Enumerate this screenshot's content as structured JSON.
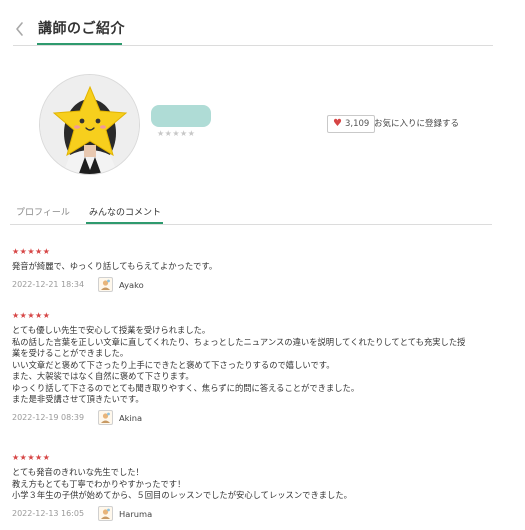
{
  "header": {
    "title": "講師のご紹介",
    "back_icon": "chevron-left-icon"
  },
  "profile": {
    "rating_stars": "★★★★★",
    "favorite_count": "3,109",
    "favorite_label": "お気に入りに登録する",
    "heart_icon": "♥",
    "colors": {
      "accent": "#2e9a6e",
      "name_pill": "#afdcd6",
      "star_rating": "#d64545",
      "heart": "#d64545"
    }
  },
  "tabs": [
    {
      "label": "プロフィール",
      "active": false
    },
    {
      "label": "みんなのコメント",
      "active": true
    }
  ],
  "comments": [
    {
      "stars": "★★★★★",
      "lines": [
        "発音が綺麗で、ゆっくり話してもらえてよかったです。"
      ],
      "date": "2022-12-21 18:34",
      "user": "Ayako"
    },
    {
      "stars": "★★★★★",
      "lines": [
        "とても優しい先生で安心して授業を受けられました。",
        "私の話した言葉を正しい文章に直してくれたり、ちょっとしたニュアンスの違いを説明してくれたりしてとても充実した授",
        "業を受けることができました。",
        "いい文章だと褒めて下さったり上手にできたと褒めて下さったりするので嬉しいです。",
        "また、大袈裟ではなく自然に褒めて下さります。",
        "ゆっくり話して下さるのでとても聞き取りやすく、焦らずに的問に答えることができました。",
        "また是非受講させて頂きたいです。"
      ],
      "date": "2022-12-19 08:39",
      "user": "Akina"
    },
    {
      "stars": "★★★★★",
      "lines": [
        "とても発音のきれいな先生でした！",
        "教え方もとても丁寧でわかりやすかったです！",
        "小学３年生の子供が始めてから、５回目のレッスンでしたが安心してレッスンできました。"
      ],
      "date": "2022-12-13 16:05",
      "user": "Haruma"
    }
  ]
}
